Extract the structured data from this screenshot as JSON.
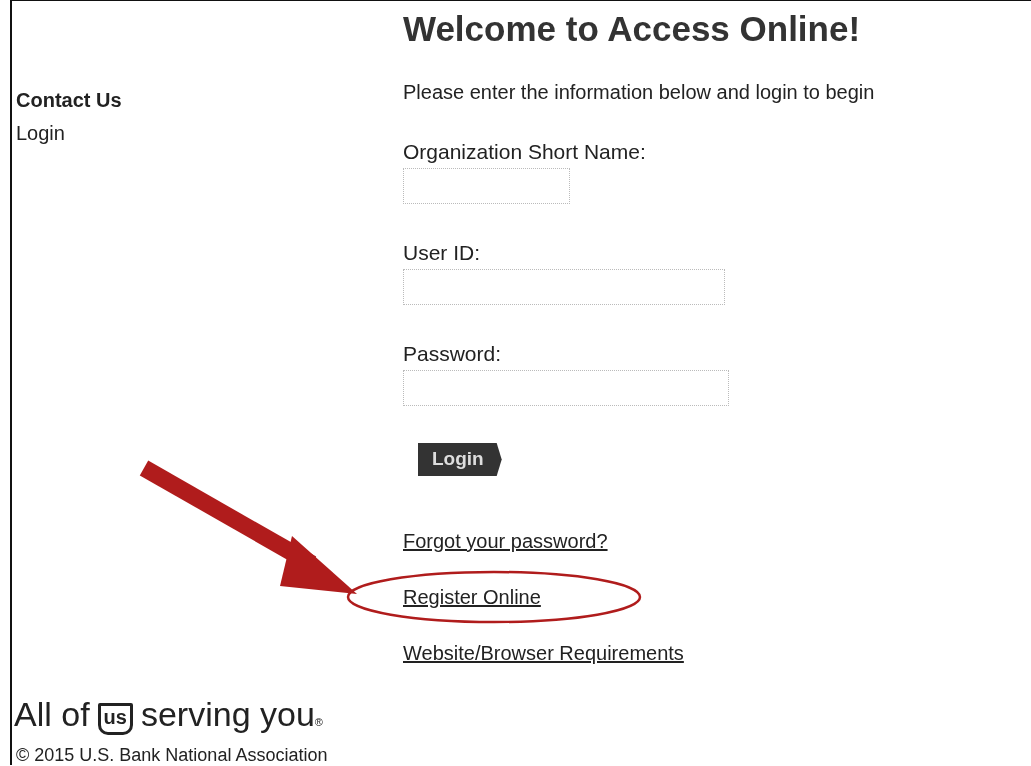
{
  "heading": "Welcome to Access Online!",
  "sidebar": {
    "items": [
      {
        "label": "Contact Us",
        "highlighted": true
      },
      {
        "label": "Login",
        "highlighted": false
      }
    ]
  },
  "form": {
    "intro": "Please enter the information below and login to begin",
    "fields": [
      {
        "label": "Organization Short Name:"
      },
      {
        "label": "User ID:"
      },
      {
        "label": "Password:"
      }
    ],
    "button": "Login",
    "links": [
      {
        "label": "Forgot your password?",
        "circled": false
      },
      {
        "label": "Register Online",
        "circled": true
      },
      {
        "label": "Website/Browser Requirements",
        "circled": false
      }
    ]
  },
  "brand": {
    "prefix": "All of",
    "mark": "us",
    "suffix": "serving you",
    "registered": "®"
  },
  "copyright": "© 2015 U.S. Bank National Association",
  "annotation": {
    "arrow": true
  }
}
